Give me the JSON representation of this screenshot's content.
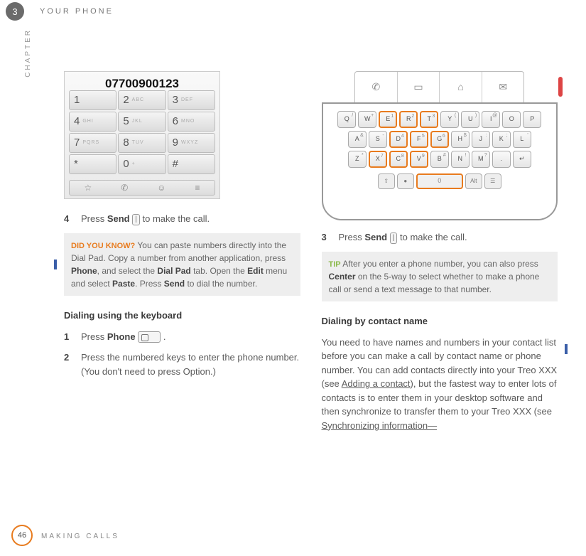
{
  "header": {
    "chapter_number": "3",
    "title": "YOUR PHONE",
    "chapter_label": "CHAPTER"
  },
  "left_col": {
    "dialpad": {
      "display": "07700900123",
      "keys": [
        {
          "n": "1",
          "t": ""
        },
        {
          "n": "2",
          "t": "ABC"
        },
        {
          "n": "3",
          "t": "DEF"
        },
        {
          "n": "4",
          "t": "GHI"
        },
        {
          "n": "5",
          "t": "JKL"
        },
        {
          "n": "6",
          "t": "MNO"
        },
        {
          "n": "7",
          "t": "PQRS"
        },
        {
          "n": "8",
          "t": "TUV"
        },
        {
          "n": "9",
          "t": "WXYZ"
        },
        {
          "n": "*",
          "t": ""
        },
        {
          "n": "0",
          "t": "+"
        },
        {
          "n": "#",
          "t": ""
        }
      ]
    },
    "step4": {
      "num": "4",
      "pre": "Press ",
      "bold": "Send",
      "icon": "|",
      "post": " to make the call."
    },
    "dyk": {
      "label": "DID YOU KNOW?",
      "t1": " You can paste numbers directly into the Dial Pad. Copy a number from another application, press ",
      "b1": "Phone",
      "t2": ", and select the ",
      "b2": "Dial Pad",
      "t3": " tab. Open the ",
      "b3": "Edit",
      "t4": " menu and select ",
      "b4": "Paste",
      "t5": ". Press ",
      "b5": "Send",
      "t6": " to dial the number."
    },
    "h_keyboard": "Dialing using the keyboard",
    "step1": {
      "num": "1",
      "pre": "Press ",
      "bold": "Phone",
      "post": " ."
    },
    "step2": {
      "num": "2",
      "txt": "Press the numbered keys to enter the phone number. (You don't need to press Option.)"
    }
  },
  "right_col": {
    "keyboard": {
      "row1": [
        {
          "k": "Q",
          "s": "/"
        },
        {
          "k": "W",
          "s": "+"
        },
        {
          "k": "E",
          "s": "1",
          "hl": true
        },
        {
          "k": "R",
          "s": "2",
          "hl": true
        },
        {
          "k": "T",
          "s": "3",
          "hl": true
        },
        {
          "k": "Y",
          "s": "("
        },
        {
          "k": "U",
          "s": ")"
        },
        {
          "k": "I",
          "s": "@"
        },
        {
          "k": "O",
          "s": ""
        },
        {
          "k": "P",
          "s": ""
        }
      ],
      "row2": [
        {
          "k": "A",
          "s": "&"
        },
        {
          "k": "S",
          "s": "-"
        },
        {
          "k": "D",
          "s": "4",
          "hl": true
        },
        {
          "k": "F",
          "s": "5",
          "hl": true
        },
        {
          "k": "G",
          "s": "6",
          "hl": true
        },
        {
          "k": "H",
          "s": "$"
        },
        {
          "k": "J",
          "s": ":"
        },
        {
          "k": "K",
          "s": ";"
        },
        {
          "k": "L",
          "s": "'"
        }
      ],
      "row3": [
        {
          "k": "Z",
          "s": "*"
        },
        {
          "k": "X",
          "s": "7",
          "hl": true
        },
        {
          "k": "C",
          "s": "8",
          "hl": true
        },
        {
          "k": "V",
          "s": "9",
          "hl": true
        },
        {
          "k": "B",
          "s": "#"
        },
        {
          "k": "N",
          "s": "!"
        },
        {
          "k": "M",
          "s": "?"
        },
        {
          "k": ".",
          "s": ""
        },
        {
          "k": "↵",
          "s": ""
        }
      ],
      "space_label": "0",
      "alt_label": "Alt"
    },
    "step3": {
      "num": "3",
      "pre": "Press ",
      "bold": "Send",
      "icon": "|",
      "post": " to make the call."
    },
    "tip": {
      "label": "TIP",
      "t1": " After you enter a phone number, you can also press ",
      "b1": "Center",
      "t2": " on the 5-way to select whether to make a phone call or send a text message to that number."
    },
    "h_contact": "Dialing by contact name",
    "para": {
      "t1": "You need to have names and numbers in your contact list before you can make a call by contact name or phone number. You can add contacts directly into your Treo XXX (see ",
      "u1": "Adding a contact",
      "t2": "), but the fastest way to enter lots of contacts is to enter them in your desktop software and then synchronize to transfer them to your Treo XXX (see ",
      "u2": "Synchronizing information—"
    }
  },
  "footer": {
    "page": "46",
    "section": "MAKING CALLS"
  }
}
